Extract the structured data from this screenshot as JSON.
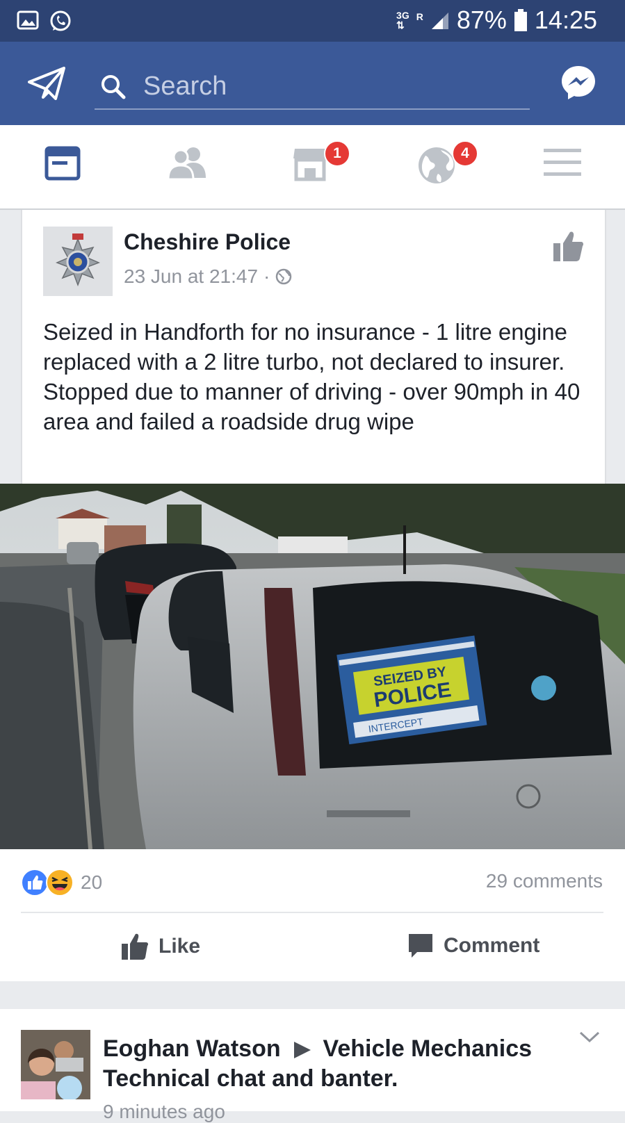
{
  "status_bar": {
    "network_type": "3G",
    "roaming": "R",
    "battery": "87%",
    "time": "14:25"
  },
  "search": {
    "placeholder": "Search"
  },
  "tabs": {
    "marketplace_badge": "1",
    "notifications_badge": "4"
  },
  "post": {
    "author": "Cheshire Police",
    "timestamp": "23 Jun at 21:47",
    "separator": "·",
    "text": "Seized in Handforth for no insurance - 1 litre engine replaced with a 2 litre turbo, not declared to insurer. Stopped due to manner of driving - over 90mph in 40 area and failed a roadside drug wipe",
    "photo_sign": {
      "line1": "SEIZED BY",
      "line2": "POLICE",
      "line3": "INTERCEPT"
    },
    "reaction_count": "20",
    "comments": "29 comments",
    "like_label": "Like",
    "comment_label": "Comment"
  },
  "next_post": {
    "author": "Eoghan Watson",
    "group": "Vehicle Mechanics Technical chat and banter.",
    "time": "9 minutes ago"
  },
  "colors": {
    "brand_blue": "#3b5998",
    "status_bar": "#2d4373",
    "badge_red": "#e53935",
    "like_blue": "#4080ff",
    "haha_yellow": "#f7b125"
  }
}
